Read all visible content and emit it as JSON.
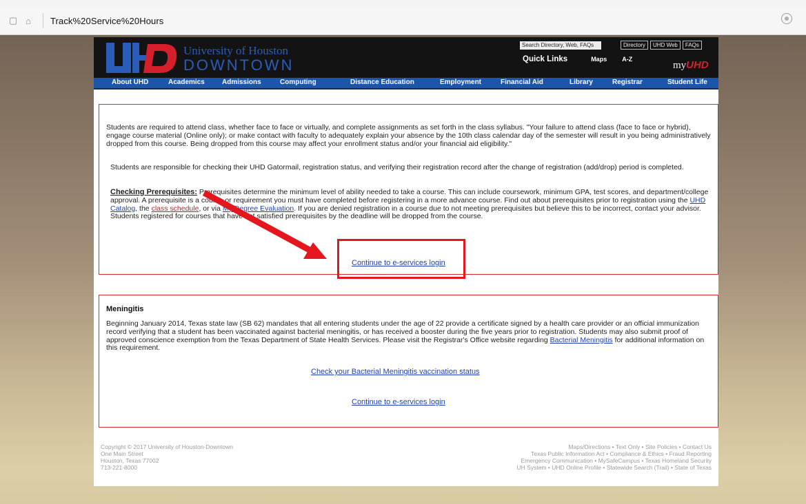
{
  "browser": {
    "address": "Track%20Service%20Hours"
  },
  "header": {
    "logo_line1": "University of Houston",
    "logo_line2": "DOWNTOWN",
    "search_placeholder": "Search Directory, Web, FAQs",
    "toplinks": [
      "Directory",
      "UHD Web",
      "FAQs"
    ],
    "quick_links": "Quick Links",
    "maps": "Maps",
    "az": "A-Z",
    "my": "my",
    "my_uhd": "UHD"
  },
  "nav": [
    "About UHD",
    "Academics",
    "Admissions",
    "Computing",
    "Distance Education",
    "Employment",
    "Financial Aid",
    "Library",
    "Registrar",
    "Student Life"
  ],
  "notice": {
    "para1": "Students are required to attend class, whether face to face or virtually, and complete assignments as set forth in the class syllabus. \"Your failure to attend class (face to face or hybrid), engage course material (Online only); or make contact with faculty to adequately explain your absence by the 10th class calendar day of the semester will result in you being administratively dropped from this course. Being dropped from this course may affect your enrollment status and/or your financial aid eligibility.\"",
    "para2": "Students are responsible for checking their UHD Gatormail, registration status, and verifying their registration record after the change of registration (add/drop) period is completed.",
    "prereq_label": "Checking Prerequisites:",
    "prereq_text1": " Prerequisites determine the minimum level of ability needed to take a course. This can include coursework, minimum GPA, test scores, and department/college approval. A prerequisite is a course or requirement you must have completed before registering in a more advance course. Find out about prerequisites prior to registration using the ",
    "catalog_link": "UHD Catalog",
    "prereq_text2": ", the ",
    "schedule_link": "class schedule",
    "prereq_text3": ", or via ",
    "degree_link": "My Degree Evaluation",
    "prereq_text4": ". If you are denied registration in a course due to not meeting prerequisites but believe this to be incorrect, contact your advisor. Students registered for courses that have not satisfied prerequisites by the deadline will be dropped from the course.",
    "continue_link": "Continue to e-services login"
  },
  "meningitis": {
    "heading": "Meningitis",
    "para1": "Beginning January 2014, Texas state law (SB 62) mandates that all entering students under the age of 22 provide a certificate signed by a health care provider or an official immunization record verifying that a student has been vaccinated against bacterial meningitis, or has received a booster during the five years prior to registration. Students may also submit proof of approved conscience exemption from the Texas Department of State Health Services. Please visit the Registrar's Office website regarding ",
    "bm_link": "Bacterial Meningitis",
    "para1_end": " for additional information on this requirement.",
    "check_link": "Check your Bacterial Meningitis vaccination status",
    "continue_link": "Continue to e-services login"
  },
  "footer": {
    "left": [
      "Copyright © 2017 University of Houston-Downtown",
      "One Main Street",
      "Houston, Texas 77002",
      "713-221-8000"
    ],
    "right": [
      "Maps/Directions • Text Only • Site Policies • Contact Us",
      "Texas Public Information Act • Compliance & Ethics • Fraud Reporting",
      "Emergency Communication • MySafeCampus • Texas Homeland Security",
      "UH System • UHD Online Profile • Statewide Search (Trail) • State of Texas"
    ]
  },
  "colors": {
    "uhd_blue": "#1d55a8",
    "uhd_red": "#d51f2b",
    "annotation_red": "#e5171e"
  }
}
